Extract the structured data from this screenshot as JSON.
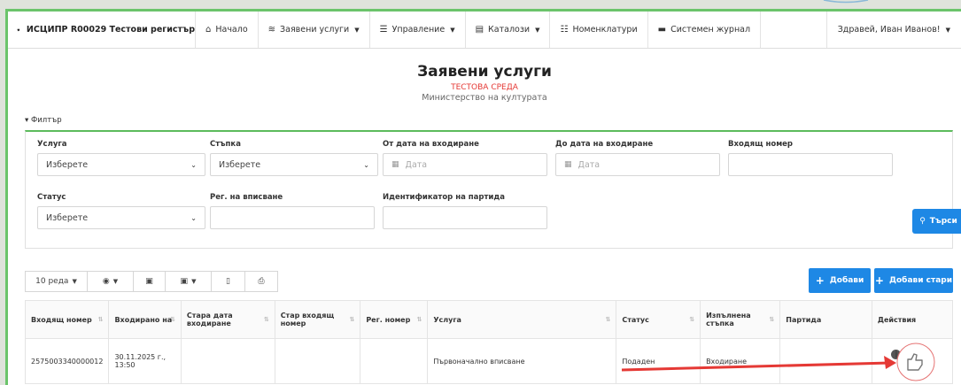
{
  "app": {
    "title": "ИСЦИПР R00029 Тестови регистър"
  },
  "nav": {
    "items": [
      {
        "label": "Начало",
        "icon": "home-icon",
        "glyph": "⌂",
        "caret": false
      },
      {
        "label": "Заявени услуги",
        "icon": "layers-icon",
        "glyph": "≋",
        "caret": true
      },
      {
        "label": "Управление",
        "icon": "sliders-icon",
        "glyph": "☰",
        "caret": true
      },
      {
        "label": "Каталози",
        "icon": "book-icon",
        "glyph": "▤",
        "caret": true
      },
      {
        "label": "Номенклатури",
        "icon": "list-icon",
        "glyph": "☷",
        "caret": false
      },
      {
        "label": "Системен журнал",
        "icon": "journal-icon",
        "glyph": "▬",
        "caret": false
      }
    ],
    "user": "Здравей, Иван Иванов!"
  },
  "header": {
    "title": "Заявени услуги",
    "environment": "ТЕСТОВА СРЕДА",
    "ministry": "Министерство на културата",
    "filter_toggle": "▾ Филтър"
  },
  "filter": {
    "service_label": "Услуга",
    "service_value": "Изберете",
    "step_label": "Стъпка",
    "step_value": "Изберете",
    "from_date_label": "От дата на входиране",
    "from_date_placeholder": "Дата",
    "to_date_label": "До дата на входиране",
    "to_date_placeholder": "Дата",
    "incoming_number_label": "Входящ номер",
    "status_label": "Статус",
    "status_value": "Изберете",
    "reg_label": "Рег. на вписване",
    "batch_label": "Идентификатор на партида",
    "search_label": "Търси"
  },
  "toolbar": {
    "page_size": "10 реда",
    "add": "Добави",
    "add_old": "Добави стари"
  },
  "table": {
    "headers": [
      "Входящ номер",
      "Входирано на",
      "Стара дата входиране",
      "Стар входящ номер",
      "Рег. номер",
      "Услуга",
      "Статус",
      "Изпълнена стъпка",
      "Партида",
      "Действия"
    ],
    "rows": [
      {
        "incoming_number": "2575003340000012",
        "entered_on": "30.11.2025 г., 13:50",
        "old_date": "",
        "old_number": "",
        "reg_number": "",
        "service": "Първоначално вписване",
        "status": "Подаден",
        "step": "Входиране",
        "batch": ""
      }
    ]
  },
  "colors": {
    "accent": "#1e88e5",
    "highlight_border": "#6bc46b",
    "annotation_arrow": "#e53935"
  }
}
